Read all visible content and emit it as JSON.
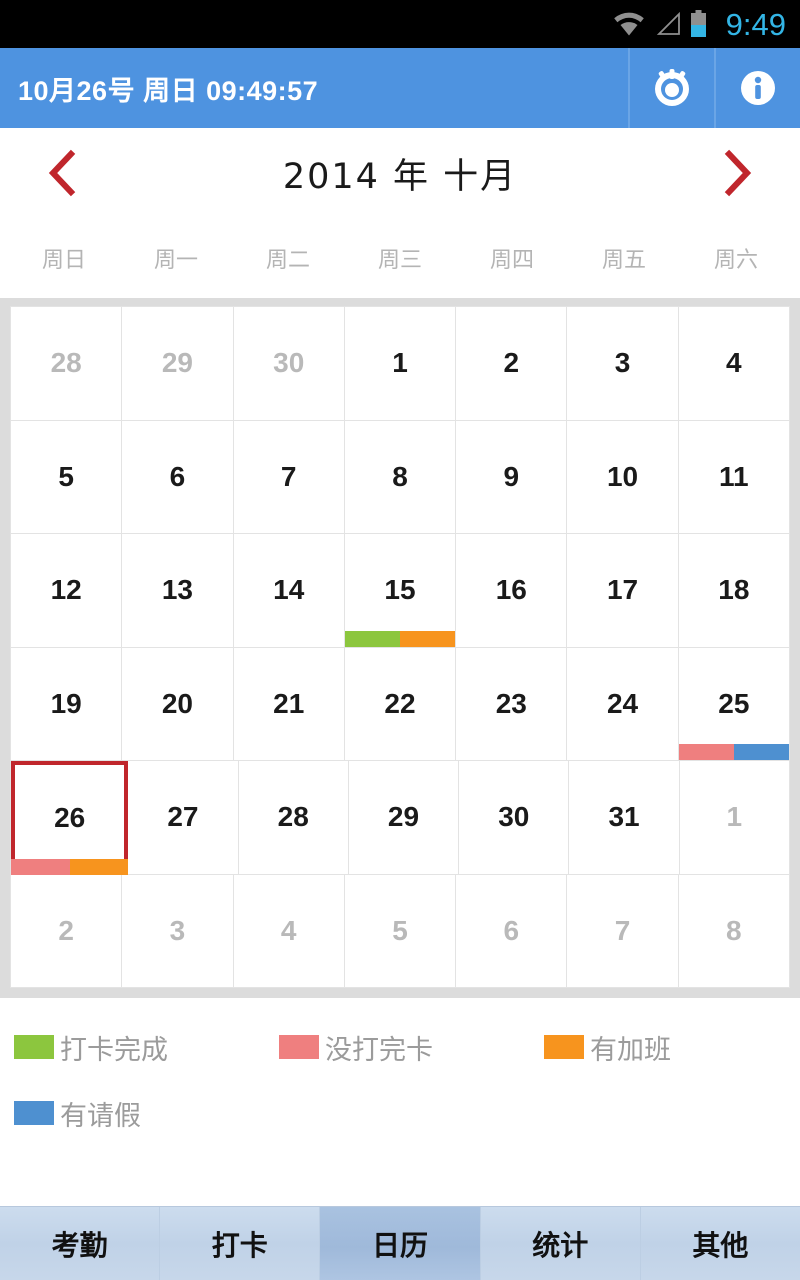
{
  "statusbar": {
    "clock": "9:49",
    "icons": [
      "wifi-icon",
      "signal-icon",
      "battery-icon"
    ],
    "clock_color": "#33b5e5"
  },
  "actionbar": {
    "title": "10月26号 周日 09:49:57",
    "background": "#4e93e0",
    "buttons": [
      {
        "name": "alarm-button",
        "icon": "alarm-icon"
      },
      {
        "name": "info-button",
        "icon": "info-icon"
      }
    ]
  },
  "month_header": {
    "prev_icon": "chevron-left-icon",
    "next_icon": "chevron-right-icon",
    "title": "2014 年 十月",
    "arrow_color": "#c0262c"
  },
  "weekdays": [
    "周日",
    "周一",
    "周二",
    "周三",
    "周四",
    "周五",
    "周六"
  ],
  "calendar": {
    "year": 2014,
    "month": 10,
    "selected_day": 26,
    "weeks": [
      [
        {
          "label": "28",
          "muted": true,
          "marks": []
        },
        {
          "label": "29",
          "muted": true,
          "marks": []
        },
        {
          "label": "30",
          "muted": true,
          "marks": []
        },
        {
          "label": "1",
          "muted": false,
          "marks": []
        },
        {
          "label": "2",
          "muted": false,
          "marks": []
        },
        {
          "label": "3",
          "muted": false,
          "marks": []
        },
        {
          "label": "4",
          "muted": false,
          "marks": []
        }
      ],
      [
        {
          "label": "5",
          "muted": false,
          "marks": []
        },
        {
          "label": "6",
          "muted": false,
          "marks": []
        },
        {
          "label": "7",
          "muted": false,
          "marks": []
        },
        {
          "label": "8",
          "muted": false,
          "marks": []
        },
        {
          "label": "9",
          "muted": false,
          "marks": []
        },
        {
          "label": "10",
          "muted": false,
          "marks": []
        },
        {
          "label": "11",
          "muted": false,
          "marks": []
        }
      ],
      [
        {
          "label": "12",
          "muted": false,
          "marks": []
        },
        {
          "label": "13",
          "muted": false,
          "marks": []
        },
        {
          "label": "14",
          "muted": false,
          "marks": []
        },
        {
          "label": "15",
          "muted": false,
          "marks": [
            "#8cc63e",
            "#f7941e"
          ]
        },
        {
          "label": "16",
          "muted": false,
          "marks": []
        },
        {
          "label": "17",
          "muted": false,
          "marks": []
        },
        {
          "label": "18",
          "muted": false,
          "marks": []
        }
      ],
      [
        {
          "label": "19",
          "muted": false,
          "marks": []
        },
        {
          "label": "20",
          "muted": false,
          "marks": []
        },
        {
          "label": "21",
          "muted": false,
          "marks": []
        },
        {
          "label": "22",
          "muted": false,
          "marks": []
        },
        {
          "label": "23",
          "muted": false,
          "marks": []
        },
        {
          "label": "24",
          "muted": false,
          "marks": []
        },
        {
          "label": "25",
          "muted": false,
          "marks": [
            "#ef7f7f",
            "#4e90d0"
          ]
        }
      ],
      [
        {
          "label": "26",
          "muted": false,
          "selected": true,
          "marks": [
            "#ef7f7f",
            "#f7941e"
          ]
        },
        {
          "label": "27",
          "muted": false,
          "marks": []
        },
        {
          "label": "28",
          "muted": false,
          "marks": []
        },
        {
          "label": "29",
          "muted": false,
          "marks": []
        },
        {
          "label": "30",
          "muted": false,
          "marks": []
        },
        {
          "label": "31",
          "muted": false,
          "marks": []
        },
        {
          "label": "1",
          "muted": true,
          "marks": []
        }
      ],
      [
        {
          "label": "2",
          "muted": true,
          "marks": []
        },
        {
          "label": "3",
          "muted": true,
          "marks": []
        },
        {
          "label": "4",
          "muted": true,
          "marks": []
        },
        {
          "label": "5",
          "muted": true,
          "marks": []
        },
        {
          "label": "6",
          "muted": true,
          "marks": []
        },
        {
          "label": "7",
          "muted": true,
          "marks": []
        },
        {
          "label": "8",
          "muted": true,
          "marks": []
        }
      ]
    ]
  },
  "legend": [
    {
      "label": "打卡完成",
      "color": "#8cc63e"
    },
    {
      "label": "没打完卡",
      "color": "#ef7f7f"
    },
    {
      "label": "有加班",
      "color": "#f7941e"
    },
    {
      "label": "有请假",
      "color": "#4e90d0"
    }
  ],
  "tabs": [
    {
      "label": "考勤",
      "active": false
    },
    {
      "label": "打卡",
      "active": false
    },
    {
      "label": "日历",
      "active": true
    },
    {
      "label": "统计",
      "active": false
    },
    {
      "label": "其他",
      "active": false
    }
  ]
}
